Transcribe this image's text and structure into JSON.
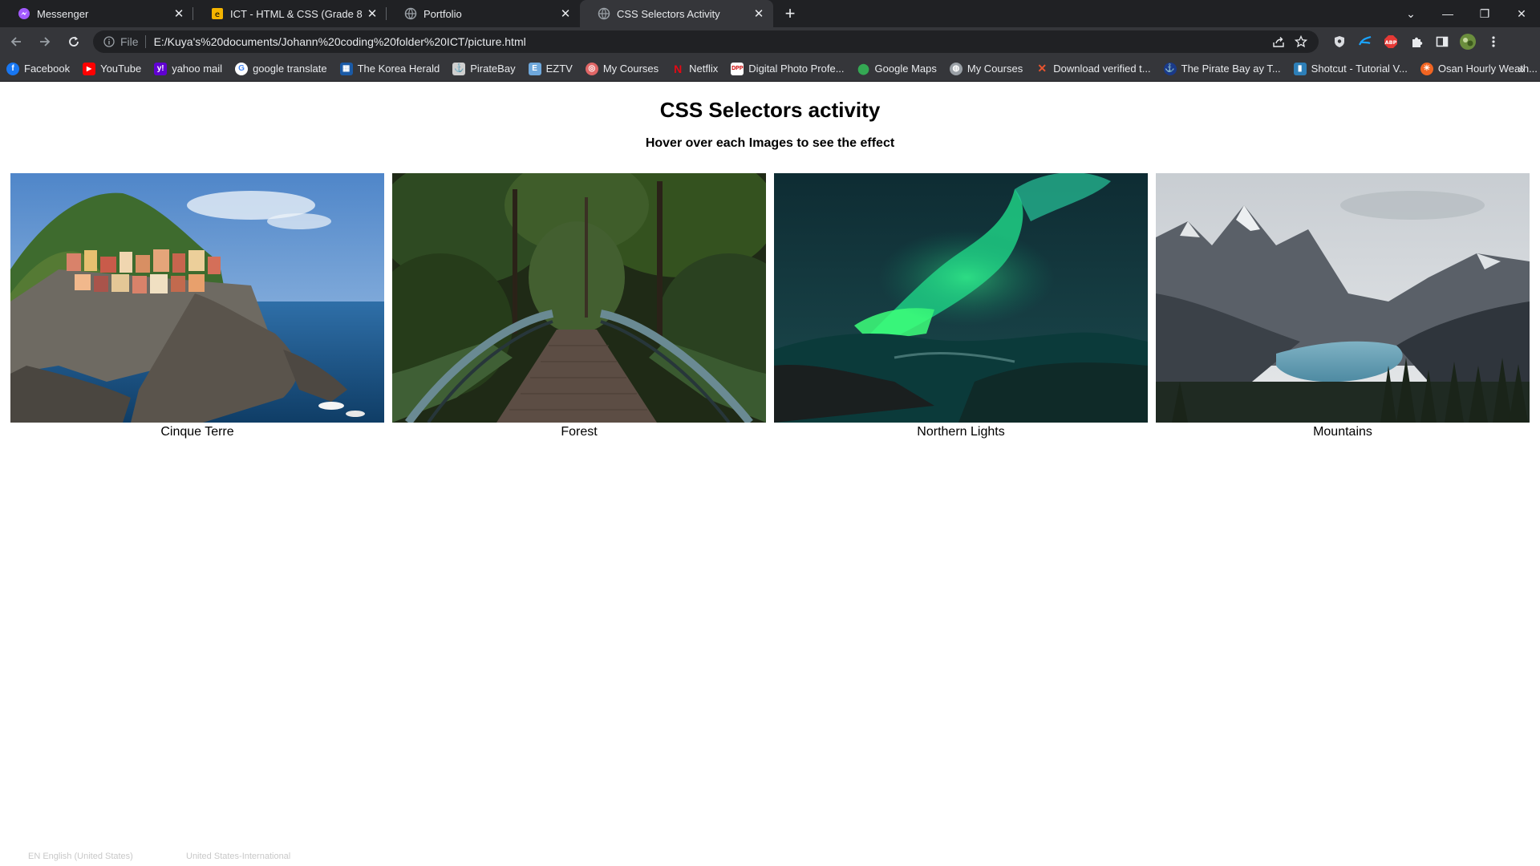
{
  "browser": {
    "tabs": [
      {
        "title": "Messenger",
        "icon": "messenger-icon",
        "active": false
      },
      {
        "title": "ICT - HTML & CSS (Grade 8 - Pas",
        "icon": "document-icon",
        "active": false
      },
      {
        "title": "Portfolio",
        "icon": "globe-icon",
        "active": false
      },
      {
        "title": "CSS Selectors Activity",
        "icon": "globe-icon",
        "active": true
      }
    ],
    "address": {
      "scheme": "File",
      "url": "E:/Kuya's%20documents/Johann%20coding%20folder%20ICT/picture.html"
    },
    "bookmarks": [
      {
        "label": "Facebook",
        "icon": "facebook-icon",
        "color": "#1877f2"
      },
      {
        "label": "YouTube",
        "icon": "youtube-icon",
        "color": "#ff0000"
      },
      {
        "label": "yahoo mail",
        "icon": "yahoo-icon",
        "color": "#6001d2"
      },
      {
        "label": "google translate",
        "icon": "google-icon",
        "color": "#e8eaed"
      },
      {
        "label": "The Korea Herald",
        "icon": "korea-herald-icon",
        "color": "#1a5aa6"
      },
      {
        "label": "PirateBay",
        "icon": "piratebay-icon",
        "color": "#cfcfcf"
      },
      {
        "label": "EZTV",
        "icon": "eztv-icon",
        "color": "#6fa8dc"
      },
      {
        "label": "My Courses",
        "icon": "courses-icon",
        "color": "#e06666"
      },
      {
        "label": "Netflix",
        "icon": "netflix-icon",
        "color": "#e50914"
      },
      {
        "label": "Digital Photo Profe...",
        "icon": "photo-icon",
        "color": "#ffffff"
      },
      {
        "label": "Google Maps",
        "icon": "maps-icon",
        "color": "#34a853"
      },
      {
        "label": "My Courses",
        "icon": "globe-icon",
        "color": "#9aa0a6"
      },
      {
        "label": "Download verified t...",
        "icon": "x-icon",
        "color": "#e8542f"
      },
      {
        "label": "The Pirate Bay ay T...",
        "icon": "piratebay-icon",
        "color": "#1a3a8a"
      },
      {
        "label": "Shotcut - Tutorial V...",
        "icon": "shotcut-icon",
        "color": "#2d7fb8"
      },
      {
        "label": "Osan Hourly Weath...",
        "icon": "weather-icon",
        "color": "#f26522"
      }
    ]
  },
  "page": {
    "title": "CSS Selectors activity",
    "subtitle": "Hover over each Images to see the effect",
    "images": [
      {
        "caption": "Cinque Terre"
      },
      {
        "caption": "Forest"
      },
      {
        "caption": "Northern Lights"
      },
      {
        "caption": "Mountains"
      }
    ]
  },
  "taskbar_hint": {
    "language": "EN English (United States)",
    "keyboard": "United States-International"
  }
}
